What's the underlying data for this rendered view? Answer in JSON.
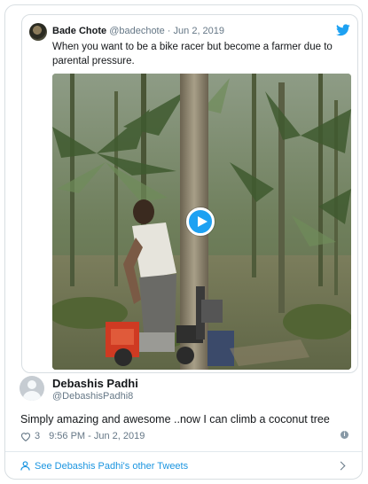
{
  "quoted_tweet": {
    "name": "Bade Chote",
    "handle": "@badechote",
    "separator": "·",
    "date": "Jun 2, 2019",
    "text": "When you want to be a bike racer but become a farmer due to parental pressure."
  },
  "tweet": {
    "name": "Debashis Padhi",
    "handle": "@DebashisPadhi8",
    "text": "Simply amazing and awesome ..now I can climb a coconut tree",
    "like_count": "3",
    "timestamp": "9:56 PM - Jun 2, 2019"
  },
  "footer": {
    "link_text": "See Debashis Padhi's other Tweets"
  },
  "colors": {
    "accent": "#1da1f2",
    "link": "#1b95e0",
    "muted": "#657786"
  }
}
